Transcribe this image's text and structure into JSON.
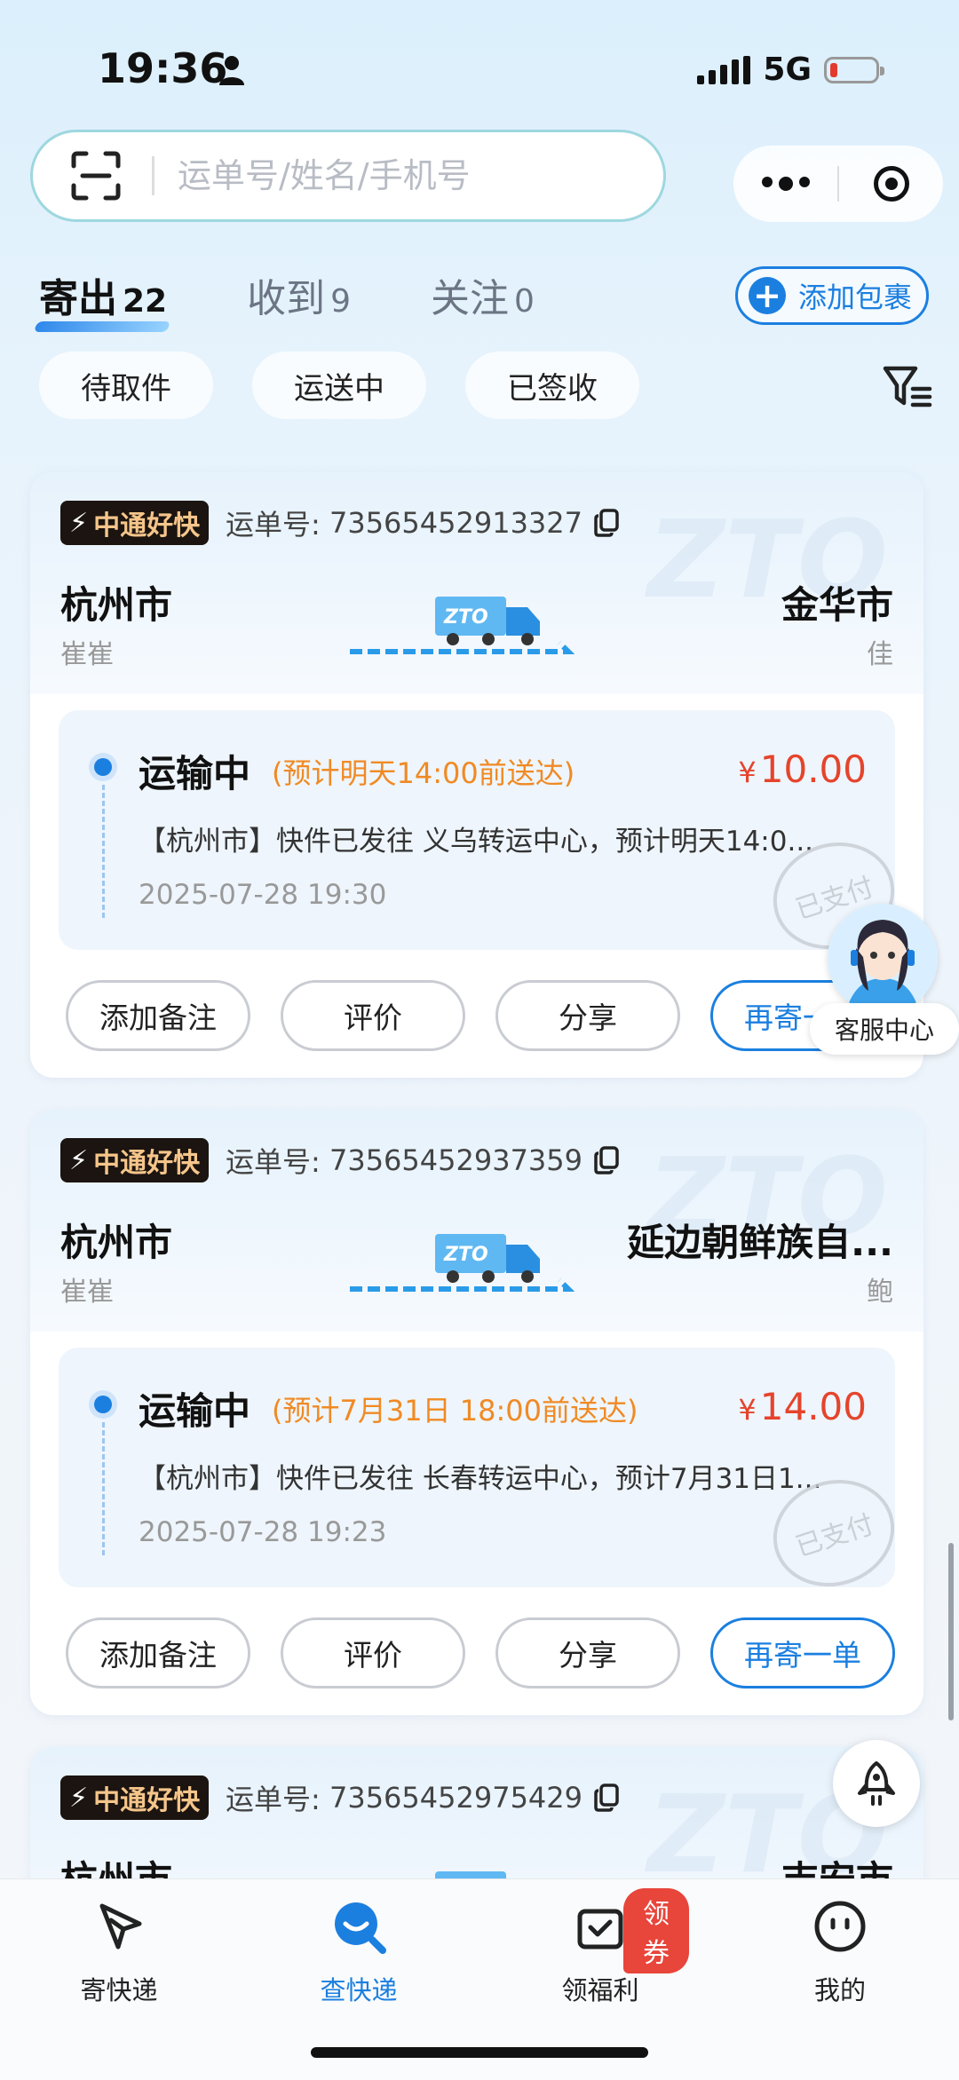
{
  "status": {
    "time": "19:36",
    "network": "5G"
  },
  "search": {
    "placeholder": "运单号/姓名/手机号"
  },
  "tabs": [
    {
      "label": "寄出",
      "count": "22"
    },
    {
      "label": "收到",
      "count": "9"
    },
    {
      "label": "关注",
      "count": "0"
    }
  ],
  "add_package": {
    "label": "添加包裹"
  },
  "chips": [
    "待取件",
    "运送中",
    "已签收"
  ],
  "cards": [
    {
      "brand": "中通好快",
      "waybill_label": "运单号:",
      "waybill": "73565452913327",
      "from_city": "杭州市",
      "from_name": "崔崔",
      "to_city": "金华市",
      "to_name": "佳",
      "status": "运输中",
      "eta": "(预计明天14:00前送达)",
      "price": "10.00",
      "message": "【杭州市】快件已发往 义乌转运中心，预计明天14:0...",
      "time": "2025-07-28 19:30",
      "stamp": "已支付",
      "actions": [
        "添加备注",
        "评价",
        "分享",
        "再寄一单"
      ]
    },
    {
      "brand": "中通好快",
      "waybill_label": "运单号:",
      "waybill": "73565452937359",
      "from_city": "杭州市",
      "from_name": "崔崔",
      "to_city": "延边朝鲜族自...",
      "to_name": "鲍",
      "status": "运输中",
      "eta": "(预计7月31日 18:00前送达)",
      "price": "14.00",
      "message": "【杭州市】快件已发往 长春转运中心，预计7月31日1...",
      "time": "2025-07-28 19:23",
      "stamp": "已支付",
      "actions": [
        "添加备注",
        "评价",
        "分享",
        "再寄一单"
      ]
    },
    {
      "brand": "中通好快",
      "waybill_label": "运单号:",
      "waybill": "73565452975429",
      "from_city": "杭州市",
      "to_city": "吉安市"
    }
  ],
  "service": {
    "label": "客服中心"
  },
  "tabbar": [
    {
      "label": "寄快递",
      "icon": "send-icon"
    },
    {
      "label": "查快递",
      "icon": "search-parcel-icon"
    },
    {
      "label": "领福利",
      "icon": "gift-icon",
      "badge": "领券"
    },
    {
      "label": "我的",
      "icon": "profile-icon"
    }
  ],
  "colors": {
    "accent": "#1b7fe0",
    "price": "#e5442c",
    "eta": "#f08a24"
  }
}
